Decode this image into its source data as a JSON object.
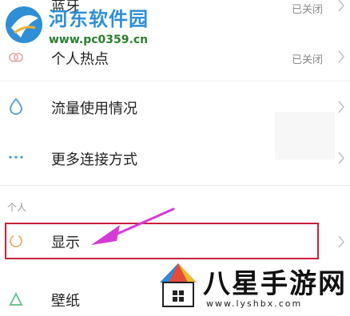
{
  "settings": {
    "rows": [
      {
        "id": "bluetooth",
        "label": "蓝牙",
        "status": "已关闭"
      },
      {
        "id": "hotspot",
        "label": "个人热点",
        "status": "已关闭"
      },
      {
        "id": "data-usage",
        "label": "流量使用情况"
      },
      {
        "id": "more-connections",
        "label": "更多连接方式"
      },
      {
        "id": "display",
        "label": "显示"
      },
      {
        "id": "wallpaper",
        "label": "壁纸"
      }
    ],
    "section_personal": "个人"
  },
  "watermark_top": {
    "title": "河东软件园",
    "url": "www.pc0359.cn"
  },
  "watermark_bottom": {
    "title": "八星手游网",
    "url": "www.lyshbx.com"
  },
  "colors": {
    "highlight": "#c8213a",
    "arrow": "#d63ad6",
    "accent": "#2f8fd6"
  }
}
